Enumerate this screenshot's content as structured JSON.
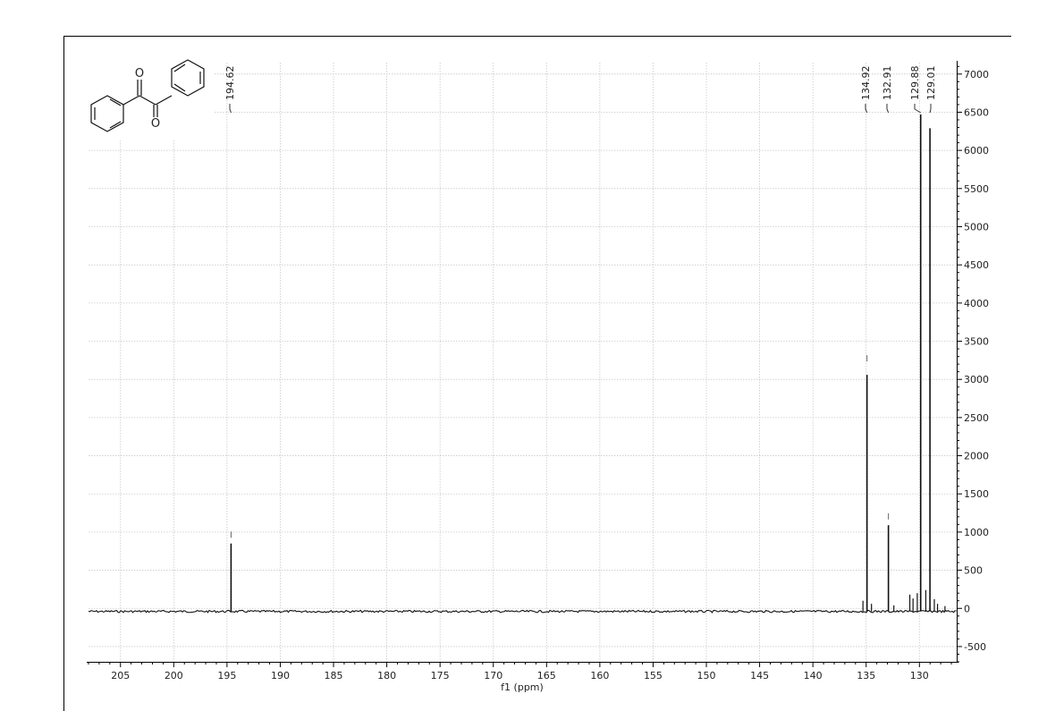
{
  "chart_data": {
    "type": "line",
    "title": "",
    "xlabel": "f1 (ppm)",
    "ylabel": "",
    "xlim": [
      208,
      126.5
    ],
    "ylim": [
      -700,
      7150
    ],
    "x_reversed": true,
    "y_axis_side": "right",
    "grid": true,
    "x_ticks": [
      205,
      200,
      195,
      190,
      185,
      180,
      175,
      170,
      165,
      160,
      155,
      150,
      145,
      140,
      135,
      130
    ],
    "x_tick_labels": [
      "205",
      "200",
      "195",
      "190",
      "185",
      "180",
      "175",
      "170",
      "165",
      "160",
      "155",
      "150",
      "145",
      "140",
      "135",
      "130"
    ],
    "y_ticks": [
      7000,
      6500,
      6000,
      5500,
      5000,
      4500,
      4000,
      3500,
      3000,
      2500,
      2000,
      1500,
      1000,
      500,
      0,
      -500
    ],
    "y_tick_labels": [
      "7000",
      "6500",
      "6000",
      "5500",
      "5000",
      "4500",
      "4000",
      "3500",
      "3000",
      "2500",
      "2000",
      "1500",
      "1000",
      "500",
      "0",
      "-500"
    ],
    "baseline": -40,
    "peaks": [
      {
        "label": "194.62",
        "x": 194.62,
        "y": 850
      },
      {
        "label": "134.92",
        "x": 134.92,
        "y": 3060
      },
      {
        "label": "132.91",
        "x": 132.91,
        "y": 1090
      },
      {
        "label": "129.88",
        "x": 129.88,
        "y": 6470
      },
      {
        "label": "129.01",
        "x": 129.01,
        "y": 6290
      }
    ],
    "minor_peaks": [
      {
        "x": 135.3,
        "y": 100
      },
      {
        "x": 134.5,
        "y": 60
      },
      {
        "x": 132.4,
        "y": 40
      },
      {
        "x": 130.9,
        "y": 180
      },
      {
        "x": 130.6,
        "y": 130
      },
      {
        "x": 130.2,
        "y": 200
      },
      {
        "x": 129.4,
        "y": 240
      },
      {
        "x": 128.6,
        "y": 120
      },
      {
        "x": 128.3,
        "y": 60
      },
      {
        "x": 127.6,
        "y": 30
      }
    ],
    "integral_marks": [
      {
        "x": 194.62,
        "y": 960
      },
      {
        "x": 134.92,
        "y": 3270
      },
      {
        "x": 132.91,
        "y": 1200
      }
    ],
    "structure": {
      "name": "benzil",
      "atom_labels": [
        "O",
        "O"
      ]
    }
  }
}
